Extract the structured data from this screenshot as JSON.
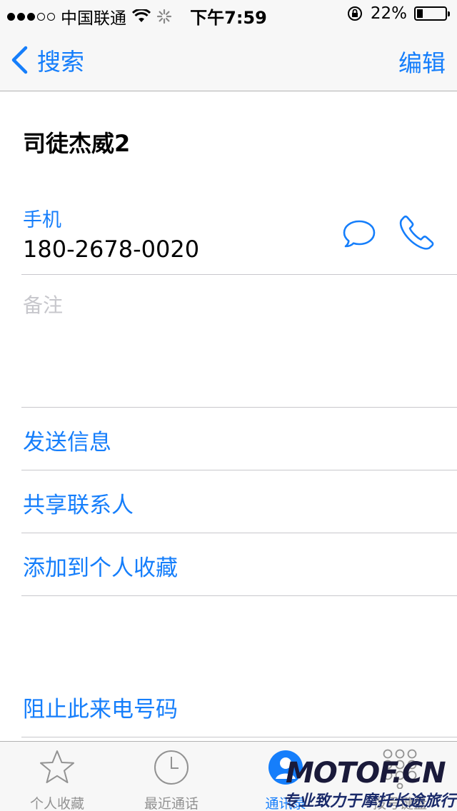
{
  "status_bar": {
    "carrier": "中国联通",
    "time": "下午7:59",
    "battery": "22%",
    "battery_level": 0.22,
    "signal_bars_filled": 3,
    "signal_bars_total": 5
  },
  "nav": {
    "back_label": "搜索",
    "edit_label": "编辑"
  },
  "contact": {
    "name": "司徒杰威2",
    "phone_label": "手机",
    "phone_number": "180-2678-0020",
    "notes_label": "备注"
  },
  "actions": {
    "send_message": "发送信息",
    "share_contact": "共享联系人",
    "add_favorites": "添加到个人收藏",
    "block_caller": "阻止此来电号码"
  },
  "tabbar": {
    "favorites": "个人收藏",
    "recents": "最近通话",
    "contacts": "通讯录",
    "keypad": "拨号键盘"
  },
  "watermark": {
    "brand": "MOTOF.CN",
    "slogan": "专业致力于摩托长途旅行"
  },
  "colors": {
    "accent": "#157efb",
    "bar_bg": "#f7f7f7",
    "divider": "#c8c7cc",
    "tab_inactive": "#929292"
  }
}
